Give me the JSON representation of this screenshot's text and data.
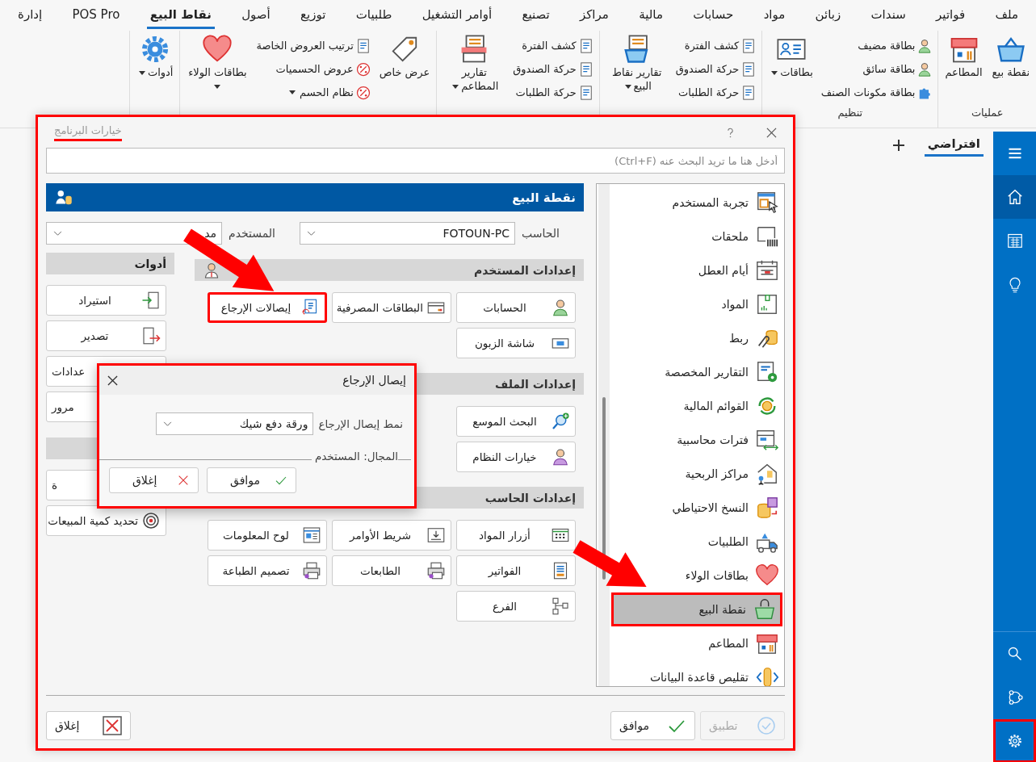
{
  "menu_bar": {
    "tabs": [
      {
        "label": "ملف",
        "selected": false
      },
      {
        "label": "فواتير",
        "selected": false
      },
      {
        "label": "سندات",
        "selected": false
      },
      {
        "label": "زبائن",
        "selected": false
      },
      {
        "label": "مواد",
        "selected": false
      },
      {
        "label": "حسابات",
        "selected": false
      },
      {
        "label": "مالية",
        "selected": false
      },
      {
        "label": "مراكز",
        "selected": false
      },
      {
        "label": "تصنيع",
        "selected": false
      },
      {
        "label": "أوامر التشغيل",
        "selected": false
      },
      {
        "label": "طلبيات",
        "selected": false
      },
      {
        "label": "توزيع",
        "selected": false
      },
      {
        "label": "أصول",
        "selected": false
      },
      {
        "label": "نقاط البيع",
        "selected": true
      },
      {
        "label": "POS Pro",
        "selected": false
      },
      {
        "label": "إدارة",
        "selected": false
      }
    ]
  },
  "ribbon": {
    "groups": [
      {
        "label": "عمليات",
        "items": [
          {
            "kind": "large",
            "label": "نقطة بيع",
            "dropdown": false
          },
          {
            "kind": "large",
            "label": "المطاعم",
            "dropdown": false
          }
        ]
      },
      {
        "label": "تنظيم",
        "items": [
          {
            "kind": "stack",
            "entries": [
              {
                "label": "بطاقة مضيف",
                "dropdown": false
              },
              {
                "label": "بطاقة سائق",
                "dropdown": false
              },
              {
                "label": "بطاقة مكونات الصنف",
                "dropdown": false
              }
            ]
          },
          {
            "kind": "large",
            "label": "بطاقات",
            "dropdown": true
          }
        ]
      },
      {
        "items": [
          {
            "kind": "stack",
            "entries": [
              {
                "label": "كشف الفترة",
                "dropdown": false
              },
              {
                "label": "حركة الصندوق",
                "dropdown": false
              },
              {
                "label": "حركة الطلبات",
                "dropdown": false
              }
            ]
          },
          {
            "kind": "large",
            "label": "تقارير نقاط البيع",
            "dropdown": true
          }
        ]
      },
      {
        "items": [
          {
            "kind": "stack",
            "entries": [
              {
                "label": "كشف الفترة",
                "dropdown": false
              },
              {
                "label": "حركة الصندوق",
                "dropdown": false
              },
              {
                "label": "حركة الطلبات",
                "dropdown": false
              }
            ]
          },
          {
            "kind": "large",
            "label": "تقارير المطاعم",
            "dropdown": true
          }
        ]
      },
      {
        "items": [
          {
            "kind": "large",
            "label": "عرض خاص",
            "dropdown": false
          },
          {
            "kind": "stack",
            "entries": [
              {
                "label": "ترتيب العروض الخاصة",
                "dropdown": false
              },
              {
                "label": "عروض الحسميات",
                "dropdown": false
              },
              {
                "label": "نظام الحسم",
                "dropdown": true
              }
            ]
          },
          {
            "kind": "large",
            "label": "بطاقات الولاء",
            "dropdown": true
          }
        ]
      },
      {
        "items": [
          {
            "kind": "large",
            "label": "أدوات",
            "dropdown": true
          }
        ]
      }
    ]
  },
  "workspace": {
    "tabs": [
      {
        "label": "افتراضي",
        "selected": true
      }
    ]
  },
  "sidebar": {
    "items": [
      {
        "selected": false,
        "highlighted": false
      },
      {
        "selected": true,
        "highlighted": false
      },
      {
        "selected": false,
        "highlighted": false
      },
      {
        "selected": false,
        "highlighted": false
      }
    ],
    "bottom_items": [
      {
        "selected": false,
        "highlighted": false
      },
      {
        "selected": false,
        "highlighted": false
      },
      {
        "selected": false,
        "highlighted": true
      }
    ]
  },
  "options_dialog": {
    "title": "خيارات البرنامج",
    "highlighted": true,
    "search": {
      "placeholder": "أدخل هنا ما تريد البحث عنه (Ctrl+F)"
    },
    "panel": {
      "title": "نقطة البيع",
      "computer": {
        "label": "الحاسب",
        "value": "FOTOUN-PC"
      },
      "user": {
        "label": "المستخدم",
        "value": "مد"
      },
      "sections": [
        {
          "title": "إعدادات المستخدم",
          "rows": [
            [
              {
                "label": "الحسابات",
                "highlighted": false
              },
              {
                "label": "البطاقات المصرفية",
                "highlighted": false
              },
              {
                "label": "إيصالات الإرجاع",
                "highlighted": true
              }
            ],
            [
              {
                "label": "شاشة الزبون",
                "highlighted": false
              }
            ]
          ]
        },
        {
          "title": "إعدادات الملف",
          "rows": [
            [
              {
                "label": "البحث الموسع",
                "highlighted": false
              }
            ],
            [
              {
                "label": "خيارات النظام",
                "highlighted": false
              }
            ]
          ]
        },
        {
          "title": "إعدادات الحاسب",
          "rows": [
            [
              {
                "label": "أزرار المواد",
                "highlighted": false
              },
              {
                "label": "شريط الأوامر",
                "highlighted": false
              },
              {
                "label": "لوح المعلومات",
                "highlighted": false
              }
            ],
            [
              {
                "label": "الفواتير",
                "highlighted": false
              },
              {
                "label": "الطابعات",
                "highlighted": false
              },
              {
                "label": "تصميم الطباعة",
                "highlighted": false
              }
            ],
            [
              {
                "label": "الفرع",
                "highlighted": false
              }
            ]
          ]
        }
      ],
      "tool_groups": [
        {
          "title": "أدوات",
          "buttons": [
            {
              "label": "استيراد",
              "clipped": false
            },
            {
              "label": "تصدير",
              "clipped": false
            },
            {
              "label": "عدادات",
              "clipped": true
            },
            {
              "label": "مرور",
              "clipped": true
            }
          ]
        },
        {
          "buttons": [
            {
              "label": "ة",
              "clipped": true
            },
            {
              "label": "تحديد كمية المبيعات",
              "clipped": false
            }
          ]
        }
      ]
    },
    "categories": [
      {
        "label": "تجربة المستخدم",
        "selected": false,
        "highlighted": false
      },
      {
        "label": "ملحقات",
        "selected": false,
        "highlighted": false
      },
      {
        "label": "أيام العطل",
        "selected": false,
        "highlighted": false
      },
      {
        "label": "المواد",
        "selected": false,
        "highlighted": false
      },
      {
        "label": "ربط",
        "selected": false,
        "highlighted": false
      },
      {
        "label": "التقارير المخصصة",
        "selected": false,
        "highlighted": false
      },
      {
        "label": "القوائم المالية",
        "selected": false,
        "highlighted": false
      },
      {
        "label": "فترات محاسبية",
        "selected": false,
        "highlighted": false
      },
      {
        "label": "مراكز الربحية",
        "selected": false,
        "highlighted": false
      },
      {
        "label": "النسخ الاحتياطي",
        "selected": false,
        "highlighted": false
      },
      {
        "label": "الطلبيات",
        "selected": false,
        "highlighted": false
      },
      {
        "label": "بطاقات الولاء",
        "selected": false,
        "highlighted": false
      },
      {
        "label": "نقطة البيع",
        "selected": true,
        "highlighted": true
      },
      {
        "label": "المطاعم",
        "selected": false,
        "highlighted": false
      },
      {
        "label": "تقليص قاعدة البيانات",
        "selected": false,
        "highlighted": false
      }
    ],
    "apply_button": {
      "label": "تطبيق",
      "disabled": true
    },
    "ok_button": {
      "label": "موافق"
    },
    "close_button": {
      "label": "إغلاق"
    }
  },
  "return_receipt_dialog": {
    "title": "إيصال الإرجاع",
    "highlighted": true,
    "field": {
      "label": "نمط إيصال الإرجاع",
      "value": "ورقة دفع شيك"
    },
    "scope": "المجال: المستخدم",
    "ok_button": {
      "label": "موافق"
    },
    "close_button": {
      "label": "إغلاق"
    }
  }
}
